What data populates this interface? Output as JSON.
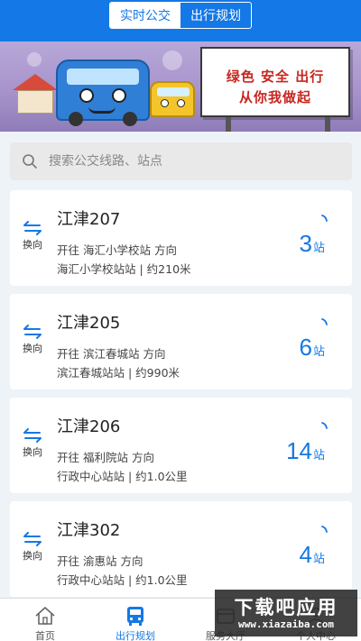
{
  "header": {
    "tabs": [
      {
        "label": "实时公交",
        "active": true
      },
      {
        "label": "出行规划",
        "active": false
      }
    ]
  },
  "banner": {
    "slogan_line1": "绿色 安全 出行",
    "slogan_line2": "从你我做起"
  },
  "search": {
    "placeholder": "搜索公交线路、站点",
    "value": ""
  },
  "routes": [
    {
      "name": "江津207",
      "direction": "开往 海汇小学校站 方向",
      "stop_info": "海汇小学校站站 | 约210米",
      "eta_num": "3",
      "eta_unit": "站",
      "swap_label": "换向"
    },
    {
      "name": "江津205",
      "direction": "开往 滨江春城站 方向",
      "stop_info": "滨江春城站站 | 约990米",
      "eta_num": "6",
      "eta_unit": "站",
      "swap_label": "换向"
    },
    {
      "name": "江津206",
      "direction": "开往 福利院站 方向",
      "stop_info": "行政中心站站 | 约1.0公里",
      "eta_num": "14",
      "eta_unit": "站",
      "swap_label": "换向"
    },
    {
      "name": "江津302",
      "direction": "开往 渝惠站 方向",
      "stop_info": "行政中心站站 | 约1.0公里",
      "eta_num": "4",
      "eta_unit": "站",
      "swap_label": "换向"
    }
  ],
  "tabbar": {
    "items": [
      {
        "label": "首页",
        "icon": "home-icon",
        "active": false
      },
      {
        "label": "出行规划",
        "icon": "bus-icon",
        "active": true
      },
      {
        "label": "服务大厅",
        "icon": "service-icon",
        "active": false
      },
      {
        "label": "个人中心",
        "icon": "user-icon",
        "active": false
      }
    ]
  },
  "watermark": {
    "main": "下载吧应用",
    "sub": "www.xiazaiba.com"
  },
  "colors": {
    "primary": "#1478e6",
    "background": "#eef3f8",
    "slogan_red": "#c8251e"
  }
}
